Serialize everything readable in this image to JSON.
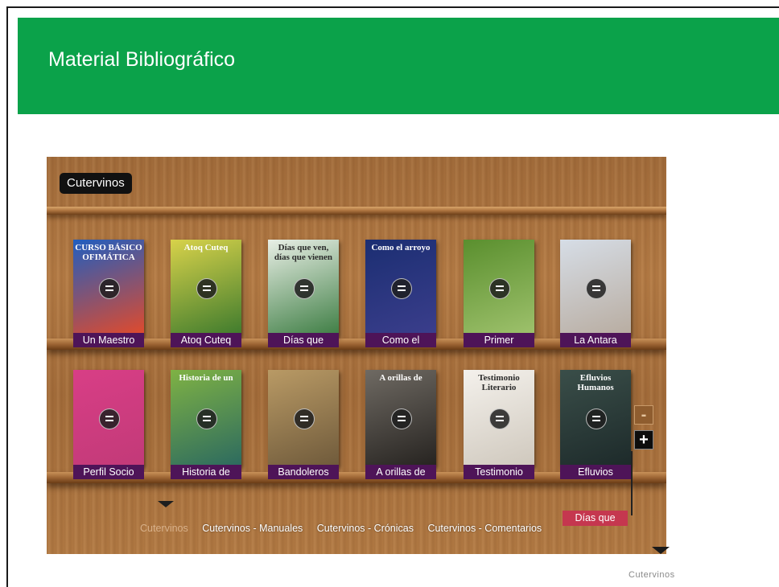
{
  "header": {
    "title": "Material Bibliográfico"
  },
  "shelf": {
    "tag": "Cutervinos",
    "rows": [
      [
        {
          "label": "Un Maestro",
          "cover_text": "CURSO BÁSICO OFIMÁTICA",
          "colors": [
            "#1f5ec0",
            "#e34a2a"
          ]
        },
        {
          "label": "Atoq Cuteq",
          "cover_text": "Atoq Cuteq",
          "colors": [
            "#d8d24a",
            "#3d7a2d"
          ]
        },
        {
          "label": "Días que",
          "cover_text": "Días que ven, días que vienen",
          "colors": [
            "#e9efe6",
            "#3d7d43"
          ]
        },
        {
          "label": "Como el",
          "cover_text": "Como el arroyo",
          "colors": [
            "#1b2e72",
            "#3b3e8c"
          ]
        },
        {
          "label": "Primer",
          "cover_text": "",
          "colors": [
            "#5a8f2e",
            "#9fc26d"
          ]
        },
        {
          "label": "La Antara",
          "cover_text": "",
          "colors": [
            "#d6dde6",
            "#b8aca0"
          ]
        }
      ],
      [
        {
          "label": "Perfil Socio",
          "cover_text": "",
          "colors": [
            "#d83e86",
            "#c23a78"
          ]
        },
        {
          "label": "Historia de",
          "cover_text": "Historia de un",
          "colors": [
            "#7fb244",
            "#2c6a5f"
          ]
        },
        {
          "label": "Bandoleros",
          "cover_text": "",
          "colors": [
            "#b99a65",
            "#6f5a3b"
          ]
        },
        {
          "label": "A orillas de",
          "cover_text": "A orillas de",
          "colors": [
            "#6f6a63",
            "#262320"
          ]
        },
        {
          "label": "Testimonio",
          "cover_text": "Testimonio Literario",
          "colors": [
            "#f4f1ec",
            "#cfc8bd"
          ]
        },
        {
          "label": "Efluvios",
          "cover_text": "Efluvios Humanos",
          "colors": [
            "#3a4e49",
            "#1d2a2a"
          ]
        }
      ]
    ],
    "zoom": {
      "minus": "-",
      "plus": "+"
    },
    "categories": [
      "Cutervinos",
      "Cutervinos - Manuales",
      "Cutervinos - Crónicas",
      "Cutervinos - Comentarios"
    ],
    "active_category": "Cutervinos",
    "pink_tag": "Días que"
  },
  "footer": {
    "label": "Cutervinos"
  }
}
